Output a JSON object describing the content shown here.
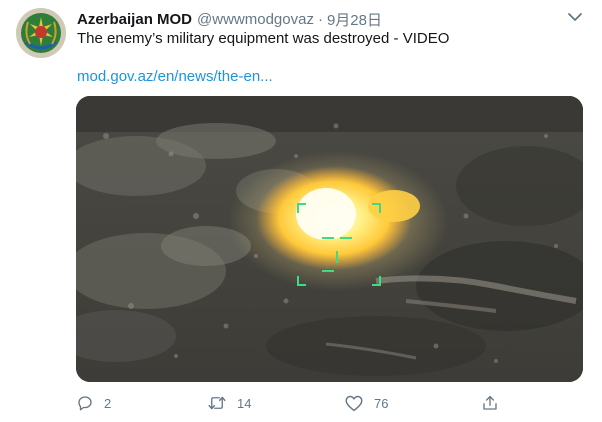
{
  "account": {
    "display_name": "Azerbaijan MOD",
    "handle": "@wwwmodgovaz",
    "separator": "·",
    "date": "9月28日"
  },
  "tweet": {
    "text": "The enemy’s military equipment was destroyed - VIDEO",
    "link": "mod.gov.az/en/news/the-en..."
  },
  "actions": {
    "reply_count": "2",
    "retweet_count": "14",
    "like_count": "76"
  },
  "icons": {
    "more": "chevron-down-icon",
    "reply": "speech-bubble-icon",
    "retweet": "retweet-arrows-icon",
    "like": "heart-icon",
    "share": "share-upload-icon"
  },
  "colors": {
    "text_primary": "#14171a",
    "text_secondary": "#657786",
    "link": "#1b95e0",
    "reticle": "#3ddc84",
    "explosion": "#ffd84a"
  }
}
